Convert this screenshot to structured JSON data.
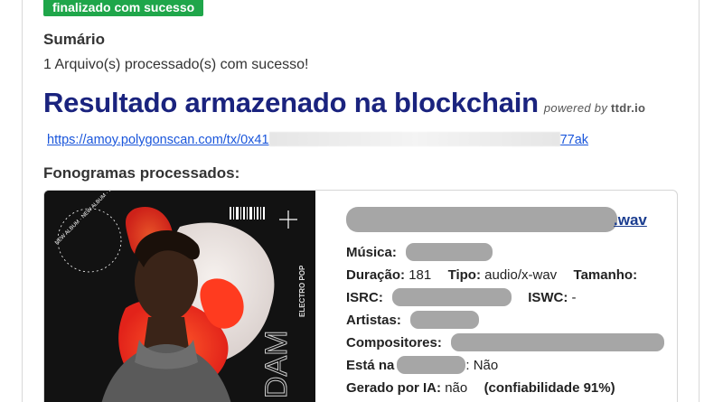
{
  "status": {
    "badge": "finalizado com sucesso",
    "color": "#1fa64a"
  },
  "summary": {
    "title": "Sumário",
    "text": "1 Arquivo(s) processado(s) com sucesso!"
  },
  "result": {
    "title": "Resultado armazenado na blockchain",
    "powered_prefix": "powered by",
    "powered_brand": "ttdr.io",
    "title_color": "#1a237e"
  },
  "tx_link": {
    "prefix": "https://amoy.polygonscan.com/tx/0x41",
    "suffix": "77ak"
  },
  "fonogramas": {
    "title": "Fonogramas processados:",
    "cover": {
      "side_text": "ELECTRO POP",
      "ring_text": "NEW ALBUM · NEW ALBUM · NEW ALBUM ·",
      "bottom_text": "DAM"
    },
    "item": {
      "file_ext": ".wav",
      "musica_label": "Música:",
      "duracao_label": "Duração:",
      "duracao_value": "181",
      "tipo_label": "Tipo:",
      "tipo_value": "audio/x-wav",
      "tamanho_label": "Tamanho:",
      "isrc_label": "ISRC:",
      "iswc_label": "ISWC:",
      "iswc_value": "-",
      "artistas_label": "Artistas:",
      "compositores_label": "Compositores:",
      "esta_na_label": "Está na",
      "esta_na_value": ": Não",
      "gerado_label": "Gerado por IA:",
      "gerado_value": "não",
      "confianca": "(confiabilidade 91%)"
    }
  }
}
